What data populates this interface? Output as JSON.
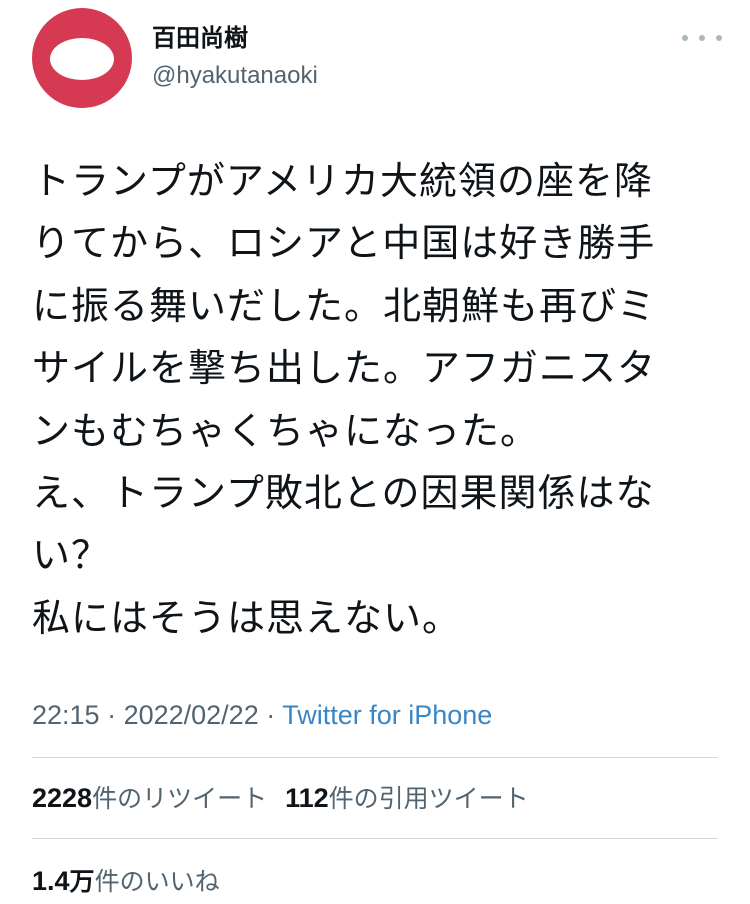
{
  "user": {
    "display_name": "百田尚樹",
    "handle": "@hyakutanaoki",
    "avatar_color": "#d63a53"
  },
  "tweet": {
    "lines": [
      "トランプがアメリカ大統領の座を降",
      "りてから、ロシアと中国は好き勝手",
      "に振る舞いだした。北朝鮮も再びミ",
      "サイルを撃ち出した。アフガニスタ",
      "ンもむちゃくちゃになった。",
      "え、トランプ敗北との因果関係はな",
      "い？",
      "私にはそうは思えない。"
    ]
  },
  "meta": {
    "time": "22:15",
    "separator1": " · ",
    "date": "2022/02/22",
    "separator2": " · ",
    "source": "Twitter for iPhone"
  },
  "stats": {
    "retweets_count": "2228",
    "retweets_label": "件のリツイート",
    "quotes_count": "112",
    "quotes_label": "件の引用ツイート",
    "likes_count_num": "1.4",
    "likes_count_unit": "万",
    "likes_label": "件のいいね"
  },
  "icons": {
    "more": "more-horizontal-icon"
  },
  "colors": {
    "link": "#3a86c4",
    "secondary_text": "#536471",
    "divider": "#cfd9de"
  }
}
